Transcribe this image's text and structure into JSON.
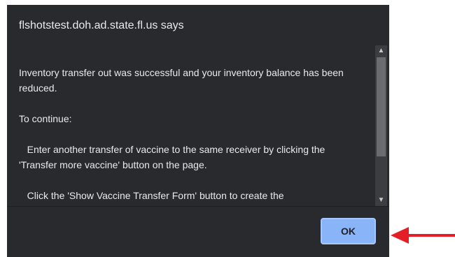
{
  "dialog": {
    "title": "flshotstest.doh.ad.state.fl.us says",
    "message": {
      "paragraph_1": "Inventory transfer out was successful and your inventory balance has been reduced.",
      "paragraph_2": "To continue:",
      "paragraph_3": "   Enter another transfer of vaccine to the same receiver by clicking the 'Transfer more vaccine' button on the page.",
      "paragraph_4": "   Click the 'Show Vaccine Transfer Form' button to create the"
    },
    "scrollbar": {
      "up_icon": "chevron-up-icon",
      "down_icon": "chevron-down-icon",
      "scroll_position": 0
    },
    "ok_button_label": "OK"
  },
  "annotation": {
    "arrow_color": "#e41e26",
    "arrow_icon": "left-arrow-icon"
  },
  "colors": {
    "dialog_background": "#292a2d",
    "button_background": "#8ab4f8",
    "text": "#e8eaed"
  }
}
